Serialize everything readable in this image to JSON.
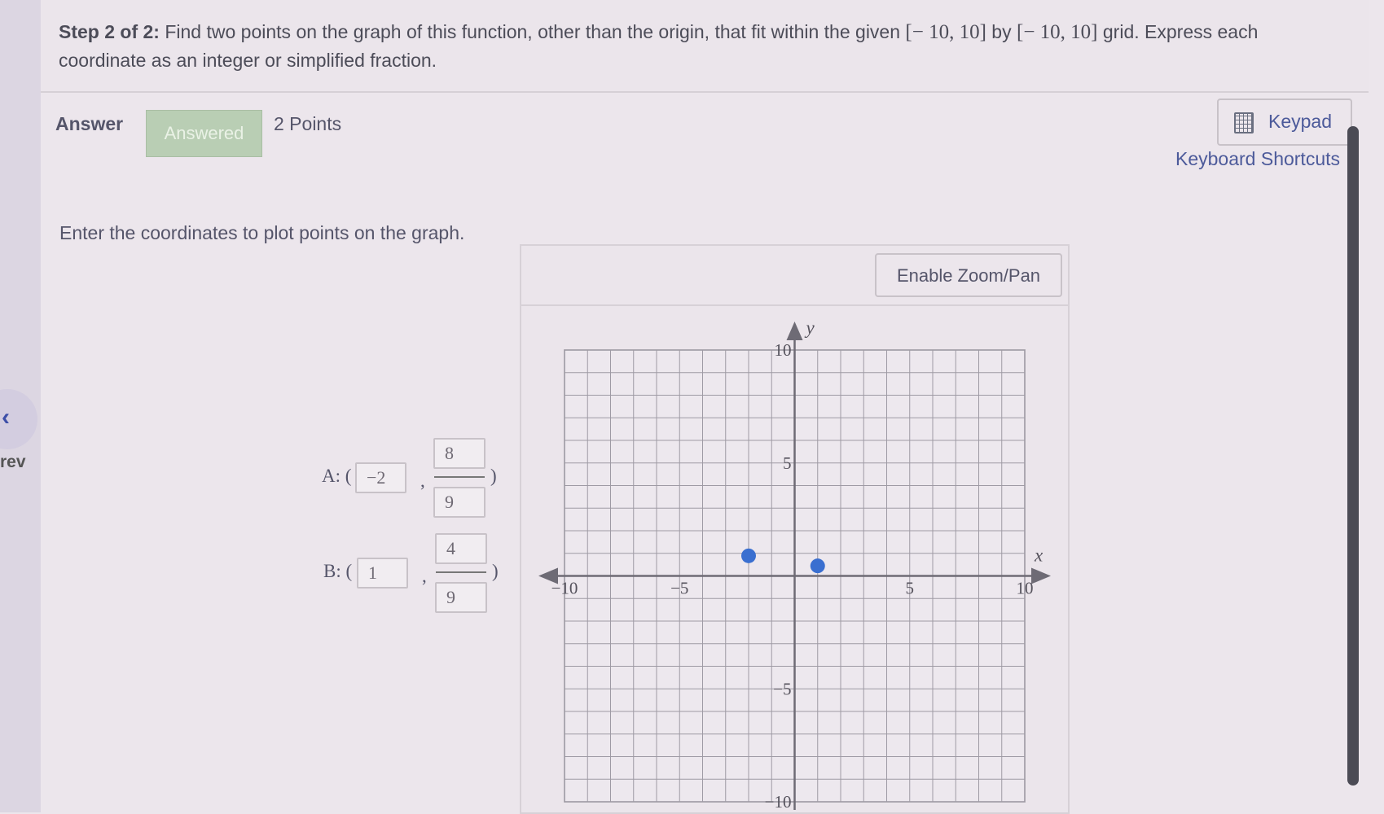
{
  "nav": {
    "prev_label": "rev",
    "prev_icon": "chevron-left-icon"
  },
  "question": {
    "step_label": "Step 2 of 2:",
    "text_part1": " Find two points on the graph of this function, other than the origin, that fit within the given ",
    "range1": "[− 10, 10]",
    "text_part2": " by ",
    "range2": "[− 10, 10]",
    "text_part3": " grid. Express each coordinate as an integer or simplified fraction."
  },
  "answer": {
    "label": "Answer",
    "status": "Answered",
    "points": "2 Points"
  },
  "toolbar": {
    "keypad_label": "Keypad",
    "shortcuts_label": "Keyboard Shortcuts",
    "zoom_label": "Enable Zoom/Pan"
  },
  "instructions": "Enter the coordinates to plot points on the graph.",
  "points": {
    "A": {
      "label": "A: (",
      "x": "−2",
      "y_num": "8",
      "y_den": "9",
      "comma": ",",
      "close": ")"
    },
    "B": {
      "label": "B: (",
      "x": "1",
      "y_num": "4",
      "y_den": "9",
      "comma": ",",
      "close": ")"
    }
  },
  "graph": {
    "x_label": "x",
    "y_label": "y",
    "x_range": [
      -10,
      10
    ],
    "y_range": [
      -10,
      10
    ],
    "grid": true,
    "tick_labels_x": [
      "−10",
      "−5",
      "5",
      "10"
    ],
    "tick_labels_y": [
      "10",
      "5",
      "−5",
      "−10"
    ],
    "point_color": "#3a6fd0",
    "plotted_points": [
      {
        "name": "A",
        "x": -2,
        "y": 0.889
      },
      {
        "name": "B",
        "x": 1,
        "y": 0.444
      }
    ]
  }
}
